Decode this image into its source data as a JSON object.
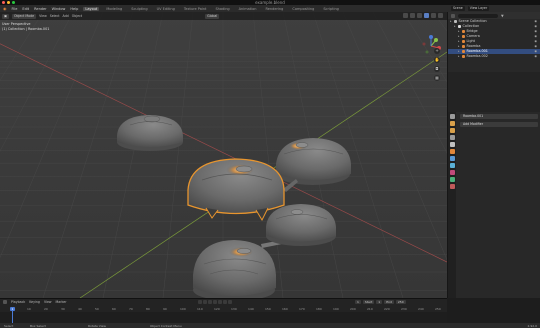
{
  "window": {
    "title": "example.blend"
  },
  "menubar": {
    "menus": [
      "File",
      "Edit",
      "Render",
      "Window",
      "Help"
    ],
    "workspaces": [
      "Layout",
      "Modeling",
      "Sculpting",
      "UV Editing",
      "Texture Paint",
      "Shading",
      "Animation",
      "Rendering",
      "Compositing",
      "Scripting"
    ],
    "active_workspace": "Layout"
  },
  "scene_field": "Scene",
  "view_layer_field": "View Layer",
  "viewport": {
    "mode": "Object Mode",
    "menus": [
      "View",
      "Select",
      "Add",
      "Object"
    ],
    "transform": "Global",
    "info_line1": "User Perspective",
    "info_line2": "(1) Collection | Roomba.001"
  },
  "outliner": {
    "rows": [
      {
        "label": "Scene Collection",
        "icon_color": "#bbbbbb",
        "selected": false,
        "indent": 0
      },
      {
        "label": "Collection",
        "icon_color": "#dddddd",
        "selected": false,
        "indent": 1
      },
      {
        "label": "Bridge",
        "icon_color": "#e2873a",
        "selected": false,
        "indent": 2
      },
      {
        "label": "Camera",
        "icon_color": "#e2873a",
        "selected": false,
        "indent": 2
      },
      {
        "label": "Light",
        "icon_color": "#e2873a",
        "selected": false,
        "indent": 2
      },
      {
        "label": "Roomba",
        "icon_color": "#e2873a",
        "selected": false,
        "indent": 2
      },
      {
        "label": "Roomba.001",
        "icon_color": "#e2873a",
        "selected": true,
        "indent": 2
      },
      {
        "label": "Roomba.002",
        "icon_color": "#e2873a",
        "selected": false,
        "indent": 2
      }
    ]
  },
  "properties": {
    "object_name": "Roomba.001",
    "add_modifier": "Add Modifier",
    "tab_colors": [
      "#9a9a9a",
      "#d8a04a",
      "#d8a04a",
      "#9a9a9a",
      "#c0c0c0",
      "#e2873a",
      "#5a9ad6",
      "#5ab0d6",
      "#c04a7a",
      "#4ab07a",
      "#c05a5a"
    ]
  },
  "timeline": {
    "menus": [
      "Playback",
      "Keying",
      "View",
      "Marker"
    ],
    "current_frame": "1",
    "start_label": "Start",
    "start": "1",
    "end_label": "End",
    "end": "250",
    "ruler": [
      "0",
      "10",
      "20",
      "30",
      "40",
      "50",
      "60",
      "70",
      "80",
      "90",
      "100",
      "110",
      "120",
      "130",
      "140",
      "150",
      "160",
      "170",
      "180",
      "190",
      "200",
      "210",
      "220",
      "230",
      "240",
      "250"
    ]
  },
  "statusbar": {
    "select": "Select",
    "box_select": "Box Select",
    "rotate_view": "Rotate View",
    "context_menu": "Object Context Menu",
    "version": "2.92.0"
  },
  "colors": {
    "accent": "#4a7ad6",
    "selection_outline": "#e8952e",
    "x_axis": "#b04a4a",
    "y_axis": "#8aa83a"
  }
}
